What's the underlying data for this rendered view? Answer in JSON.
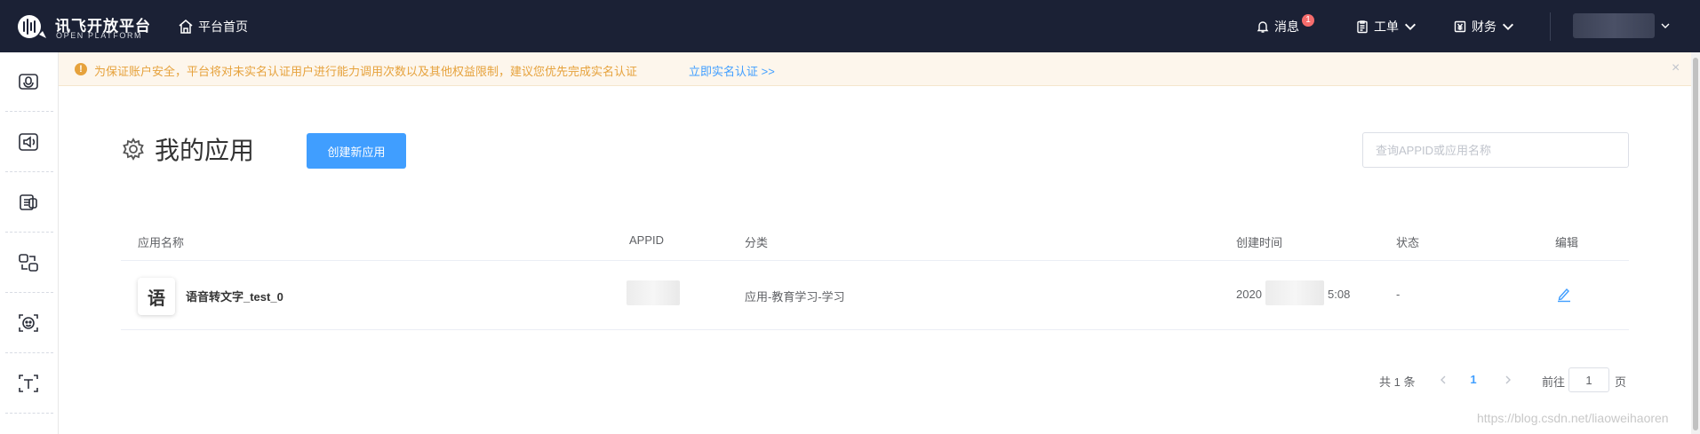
{
  "header": {
    "logo_cn": "讯飞开放平台",
    "logo_en": "OPEN PLATFORM",
    "home_label": "平台首页",
    "messages_label": "消息",
    "messages_count": "1",
    "tickets_label": "工单",
    "finance_label": "财务"
  },
  "sidebar": {
    "items": [
      {
        "icon": "speech-recognition-icon"
      },
      {
        "icon": "speech-synthesis-icon"
      },
      {
        "icon": "text-recognition-icon"
      },
      {
        "icon": "translation-icon"
      },
      {
        "icon": "face-recognition-icon"
      },
      {
        "icon": "text-tool-icon"
      }
    ]
  },
  "notice": {
    "text": "为保证账户安全，平台将对未实名认证用户进行能力调用次数以及其他权益限制，建议您优先完成实名认证",
    "link": "立即实名认证 >>",
    "close": "×"
  },
  "main": {
    "title": "我的应用",
    "create_button": "创建新应用",
    "search_placeholder": "查询APPID或应用名称"
  },
  "table": {
    "headers": [
      "应用名称",
      "APPID",
      "分类",
      "创建时间",
      "状态",
      "编辑"
    ],
    "rows": [
      {
        "avatar": "语",
        "name": "语音转文字_test_0",
        "category": "应用-教育学习-学习",
        "created_prefix": "2020",
        "created_suffix": "5:08",
        "status": "-"
      }
    ]
  },
  "pagination": {
    "total": "共 1 条",
    "current_page": "1",
    "goto_label": "前往",
    "goto_value": "1",
    "goto_unit": "页"
  },
  "watermark": "https://blog.csdn.net/liaoweihaoren",
  "colors": {
    "header_bg": "#1b2135",
    "primary": "#409eff",
    "warning": "#e6a23c",
    "notice_bg": "#fdf6ec"
  }
}
